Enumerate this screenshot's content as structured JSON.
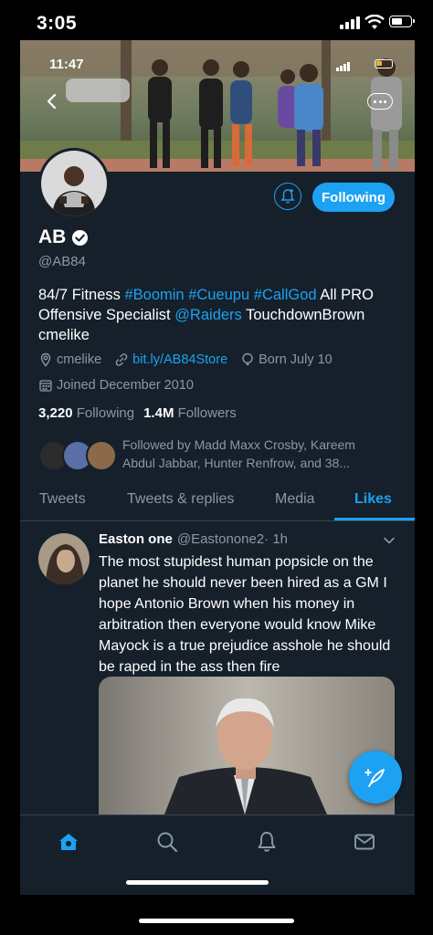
{
  "outer_status": {
    "time": "3:05"
  },
  "inner_status": {
    "time": "11:47"
  },
  "profile": {
    "name": "AB",
    "handle": "@AB84",
    "follow_button": "Following",
    "bio": {
      "text1": "84/7 Fitness ",
      "hashtag1": "#Boomin",
      "hashtag2": "#Cueupu",
      "hashtag3": "#CallGod",
      "text2": " All PRO Offensive Specialist ",
      "mention": "@Raiders",
      "text3": " TouchdownBrown cmelike"
    },
    "location": "cmelike",
    "website": "bit.ly/AB84Store",
    "birthday": "Born July 10",
    "joined": "Joined December 2010",
    "following_count": "3,220",
    "following_label": "Following",
    "followers_count": "1.4M",
    "followers_label": "Followers",
    "followed_by": "Followed by Madd Maxx Crosby, Kareem Abdul Jabbar, Hunter Renfrow, and 38..."
  },
  "tabs": [
    {
      "label": "Tweets"
    },
    {
      "label": "Tweets & replies"
    },
    {
      "label": "Media"
    },
    {
      "label": "Likes"
    }
  ],
  "active_tab": "Likes",
  "tweet": {
    "author": "Easton one",
    "handle": "@Eastonone2",
    "time": "· 1h",
    "text": "The most stupidest human popsicle on the planet he should never been hired as a GM I hope Antonio Brown when his money in arbitration then everyone would know Mike Mayock is a true prejudice asshole he should be raped in the ass then fire"
  },
  "colors": {
    "background": "#15202b",
    "accent": "#1da1f2",
    "muted": "#8899a6",
    "divider": "#38444d"
  },
  "icons": [
    "back-arrow-icon",
    "add-notification-icon",
    "verified-badge-icon",
    "location-icon",
    "link-icon",
    "balloon-icon",
    "calendar-icon",
    "chevron-down-icon",
    "compose-tweet-icon",
    "home-icon",
    "search-icon",
    "notifications-icon",
    "messages-icon"
  ]
}
